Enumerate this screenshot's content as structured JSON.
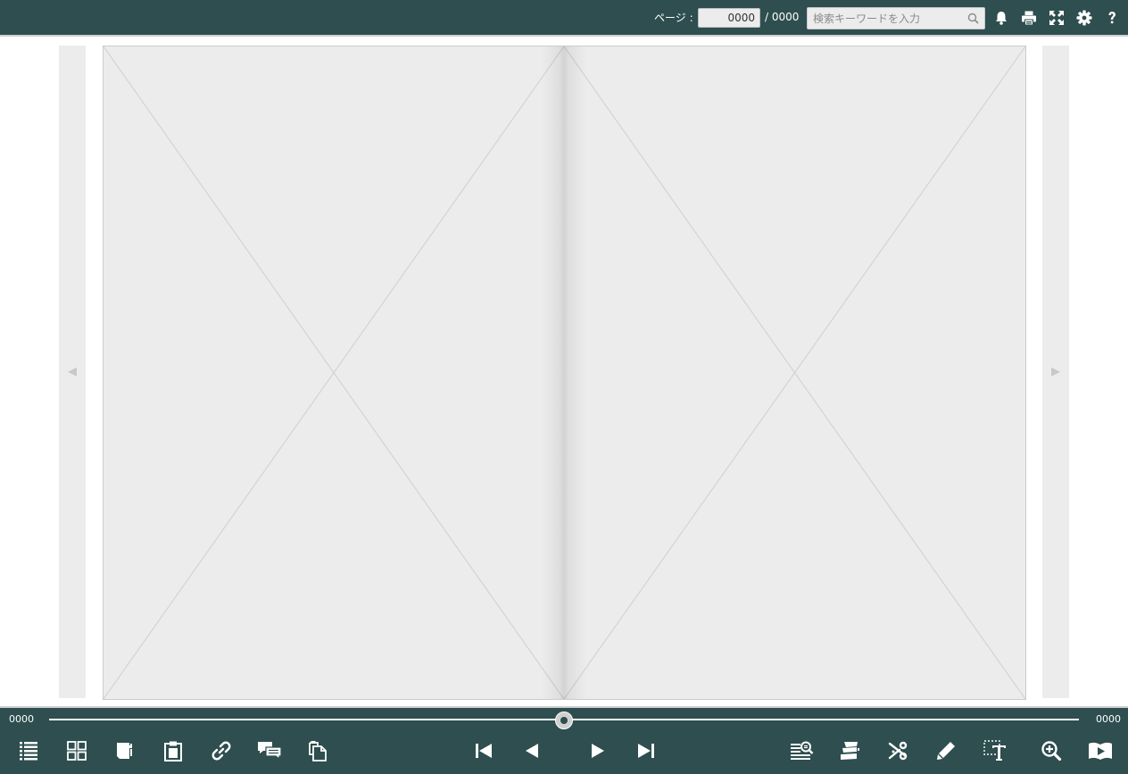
{
  "header": {
    "page_label": "ページ :",
    "current_page": "0000",
    "total_pages": "/ 0000",
    "search_placeholder": "検索キーワードを入力",
    "icons": [
      "bell-icon",
      "print-icon",
      "fullscreen-icon",
      "settings-icon",
      "help-icon"
    ]
  },
  "viewer": {
    "prev_icon": "◀",
    "next_icon": "▶",
    "pages": [
      "image-placeholder",
      "image-placeholder"
    ]
  },
  "slider": {
    "min_label": "0000",
    "max_label": "0000",
    "position": 0.5
  },
  "toolbar": {
    "left_tools": [
      "table-of-contents-icon",
      "thumbnails-icon",
      "bookmark-icon",
      "clipboard-icon",
      "link-icon",
      "comments-icon",
      "copy-pages-icon"
    ],
    "center_tools": [
      "first-page-icon",
      "previous-page-icon",
      "next-page-icon",
      "last-page-icon"
    ],
    "right_tools": [
      "search-text-icon",
      "sticky-notes-icon",
      "clip-icon",
      "pen-icon",
      "text-select-icon",
      "zoom-in-icon",
      "slideshow-icon"
    ]
  },
  "colors": {
    "bar": "#2e4e4f",
    "page_bg": "#ececec",
    "icon": "#ffffff"
  }
}
